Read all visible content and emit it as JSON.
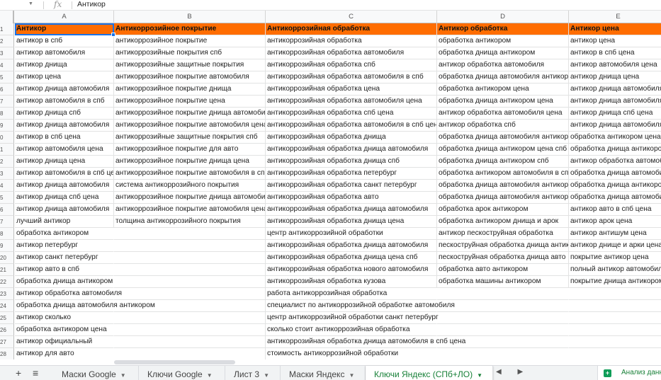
{
  "formula_bar": {
    "fx_label": "fx",
    "value": "Антикор"
  },
  "columns": [
    "A",
    "B",
    "C",
    "D",
    "E"
  ],
  "row_numbers": [
    "1",
    "2",
    "3",
    "4",
    "5",
    "6",
    "7",
    "8",
    "9",
    "0",
    "1",
    "2",
    "3",
    "4",
    "5",
    "6",
    "7",
    "8",
    "9",
    "20",
    "21",
    "22",
    "23",
    "24",
    "25",
    "26",
    "27",
    "28"
  ],
  "rows": [
    [
      "Антикор",
      "Антикоррозийное покрытие",
      "Антикоррозийная обработка",
      "Антикор обработка",
      "Антикор цена"
    ],
    [
      "антикор в спб",
      "антикоррозийное покрытие",
      "антикоррозийная обработка",
      "обработка антикором",
      "антикор цена"
    ],
    [
      "антикор автомобиля",
      "антикоррозийные покрытия спб",
      "антикоррозийная обработка автомобиля",
      "обработка днища антикором",
      "антикор в спб цена"
    ],
    [
      "антикор днища",
      "антикоррозийные защитные покрытия",
      "антикоррозийная обработка спб",
      "антикор обработка автомобиля",
      "антикор автомобиля цена"
    ],
    [
      "антикор цена",
      "антикоррозийное покрытие автомобиля",
      "антикоррозийная обработка автомобиля в спб",
      "обработка днища автомобиля антикором",
      "антикор днища цена"
    ],
    [
      "антикор днища автомобиля",
      "антикоррозийное покрытие днища",
      "антикоррозийная обработка цена",
      "обработка антикором цена",
      "антикор днища автомобиля в спб"
    ],
    [
      "антикор автомобиля в спб",
      "антикоррозийное покрытие цена",
      "антикоррозийная обработка автомобиля цена",
      "обработка днища антикором цена",
      "антикор днища автомобиля цена"
    ],
    [
      "антикор днища спб",
      "антикоррозийное покрытие днища автомобиля",
      "антикоррозийная обработка спб цена",
      "антикор обработка автомобиля цена",
      "антикор днища спб цена"
    ],
    [
      "антикор днища автомобиля",
      "антикоррозийное покрытие автомобиля цена",
      "антикоррозийная обработка автомобиля в спб цена",
      "антикор обработка спб",
      "антикор днища автомобиля"
    ],
    [
      "антикор в спб цена",
      "антикоррозийные защитные покрытия спб",
      "антикоррозийная обработка днища",
      "обработка днища автомобиля антикором цена",
      "обработка антикором цена"
    ],
    [
      "антикор автомобиля цена",
      "антикоррозийное покрытие для авто",
      "антикоррозийная обработка днища автомобиля",
      "обработка днища антикором цена спб",
      "обработка днища антикором цена"
    ],
    [
      "антикор днища цена",
      "антикоррозийное покрытие днища цена",
      "антикоррозийная обработка днища спб",
      "обработка днища антикором спб",
      "антикор обработка автомобиля"
    ],
    [
      "антикор автомобиля в спб цена",
      "антикоррозийное покрытие автомобиля в спб",
      "антикоррозийная обработка петербург",
      "обработка антикором автомобиля в спб",
      "обработка днища автомобиля"
    ],
    [
      "антикор днища автомобиля",
      "система антикоррозийного покрытия",
      "антикоррозийная обработка санкт петербург",
      "обработка днища автомобиля антикором",
      "обработка днища антикором"
    ],
    [
      "антикор днища спб цена",
      "антикоррозийное покрытие днища автомобиля",
      "антикоррозийная обработка авто",
      "обработка днища автомобиля антикором",
      "обработка днища автомобиля"
    ],
    [
      "антикор днища автомобиля",
      "антикоррозийное покрытие автомобиля цена",
      "антикоррозийная обработка днища автомобиля",
      "обработка арок антикором",
      "антикор авто в спб цена"
    ],
    [
      "лучший антикор",
      "толщина антикоррозийного покрытия",
      "антикоррозийная обработка днища цена",
      "обработка антикором днища и арок",
      "антикор арок цена"
    ],
    [
      "обработка антикором",
      "",
      "центр антикоррозийной обработки",
      "антикор пескоструйная обработка",
      "антикор антишум цена"
    ],
    [
      "антикор петербург",
      "",
      "антикоррозийная обработка днища автомобиля",
      "пескоструйная обработка днища антикор",
      "антикор днище и арки цена"
    ],
    [
      "антикор санкт петербург",
      "",
      "антикоррозийная обработка днища цена спб",
      "пескоструйная обработка днища авто",
      "покрытие антикор цена"
    ],
    [
      "антикор авто в спб",
      "",
      "антикоррозийная обработка нового автомобиля",
      "обработка авто антикором",
      "полный антикор автомобиля"
    ],
    [
      "обработка днища антикором",
      "",
      "антикоррозийная обработка кузова",
      "обработка машины антикором",
      "покрытие днища антикором"
    ],
    [
      "антикор обработка автомобиля",
      "",
      "работа антикоррозийная обработка",
      "",
      ""
    ],
    [
      "обработка днища автомобиля антикором",
      "",
      "специалист по антикоррозийной обработке автомобиля",
      "",
      ""
    ],
    [
      "антикор сколько",
      "",
      "центр антикоррозийной обработки санкт петербург",
      "",
      ""
    ],
    [
      "обработка антикором цена",
      "",
      "сколько стоит антикоррозийная обработка",
      "",
      ""
    ],
    [
      "антикор официальный",
      "",
      "антикоррозийная обработка днища автомобиля в спб цена",
      "",
      ""
    ],
    [
      "антикор для авто",
      "",
      "стоимость антикоррозийной обработки",
      "",
      ""
    ]
  ],
  "sheet_tabs": [
    {
      "label": "Маски Google"
    },
    {
      "label": "Ключи Google"
    },
    {
      "label": "Лист 3"
    },
    {
      "label": "Маски Яндекс"
    },
    {
      "label": "Ключи Яндекс (СПб+ЛО)"
    }
  ],
  "active_tab": 4,
  "tab_controls": {
    "add": "+",
    "list": "≡",
    "prev": "◀",
    "next": "▶"
  },
  "explore": {
    "label": "Анализ данных"
  },
  "colors": {
    "header_fill": "#ff6d01",
    "active_tab": "#188038",
    "selection": "#1a73e8"
  }
}
